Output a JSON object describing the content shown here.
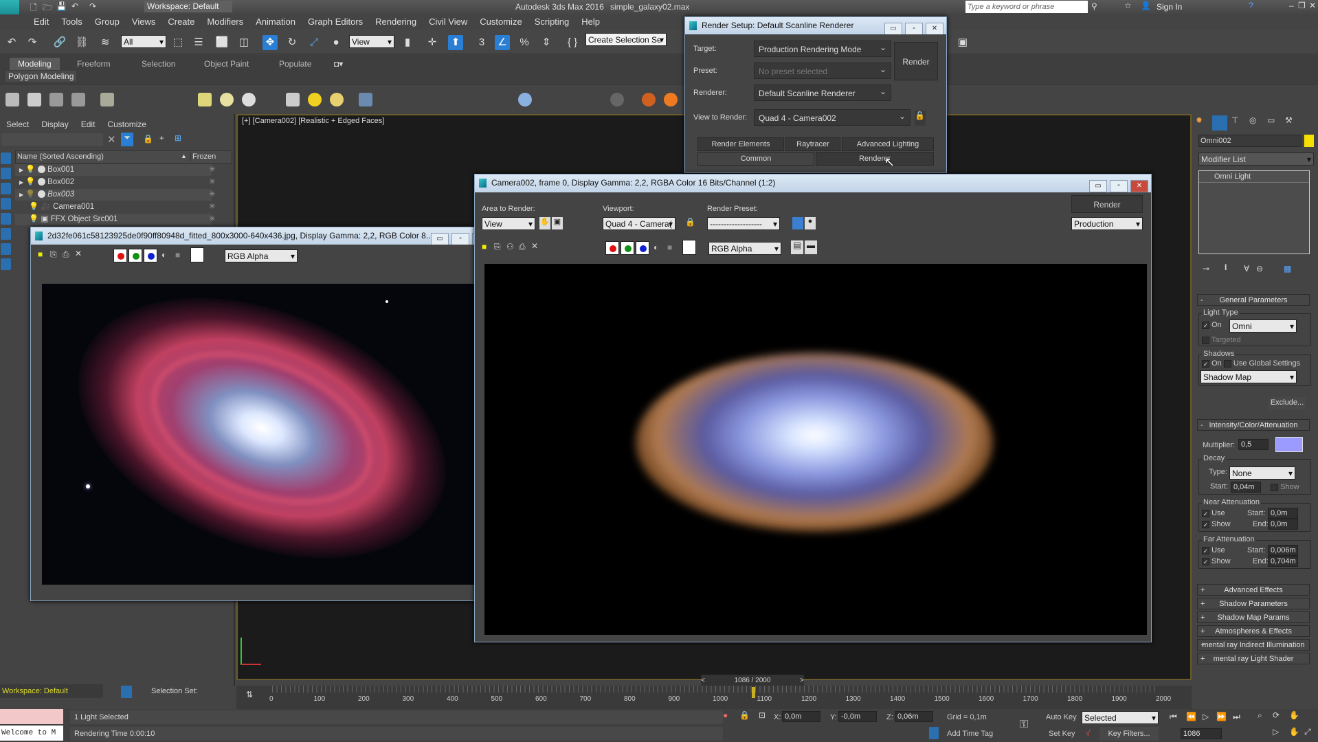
{
  "app": {
    "title": "Autodesk 3ds Max 2016",
    "file": "simple_galaxy02.max",
    "logo_text": "MAX",
    "workspace": "Workspace: Default",
    "search_placeholder": "Type a keyword or phrase",
    "sign_in": "Sign In"
  },
  "menu": [
    "Edit",
    "Tools",
    "Group",
    "Views",
    "Create",
    "Modifiers",
    "Animation",
    "Graph Editors",
    "Rendering",
    "Civil View",
    "Customize",
    "Scripting",
    "Help"
  ],
  "toolbar": {
    "selection_filter": "All",
    "ref_coord": "View",
    "named_selection": "Create Selection Se",
    "snap_number": "3"
  },
  "ribbon": {
    "tabs": [
      "Modeling",
      "Freeform",
      "Selection",
      "Object Paint",
      "Populate"
    ],
    "active_tab": "Modeling",
    "panel": "Polygon Modeling"
  },
  "explorer": {
    "menu": [
      "Select",
      "Display",
      "Edit",
      "Customize"
    ],
    "col_name": "Name (Sorted Ascending)",
    "col_frozen": "Frozen",
    "rows": [
      {
        "name": "Box001"
      },
      {
        "name": "Box002"
      },
      {
        "name": "Box003"
      },
      {
        "name": "Camera001"
      },
      {
        "name": "FFX Object Src001"
      }
    ]
  },
  "viewport": {
    "label": "[+] [Camera002] [Realistic + Edged Faces]"
  },
  "render_setup": {
    "title": "Render Setup: Default Scanline Renderer",
    "target_label": "Target:",
    "target": "Production Rendering Mode",
    "preset_label": "Preset:",
    "preset": "No preset selected",
    "renderer_label": "Renderer:",
    "renderer": "Default Scanline Renderer",
    "view_label": "View to Render:",
    "view": "Quad 4 - Camera002",
    "render": "Render",
    "tabs_row1": [
      "Render Elements",
      "Raytracer",
      "Advanced Lighting"
    ],
    "tabs_row2": [
      "Common",
      "Renderer"
    ]
  },
  "image_window": {
    "title": "2d32fe061c58123925de0f90ff80948d_fitted_800x3000-640x436.jpg, Display Gamma: 2,2, RGB Color 8...",
    "channel": "RGB Alpha"
  },
  "frame_window": {
    "title": "Camera002, frame 0, Display Gamma: 2,2, RGBA Color 16 Bits/Channel (1:2)",
    "area_label": "Area to Render:",
    "area": "View",
    "viewport_label": "Viewport:",
    "viewport": "Quad 4 - Camera(",
    "preset_label": "Render Preset:",
    "preset": "-------------------",
    "render": "Render",
    "mode": "Production",
    "channel": "RGB Alpha"
  },
  "command_panel": {
    "object_name": "Omni002",
    "object_color": "#f5e000",
    "modifier_list": "Modifier List",
    "stack_item": "Omni Light",
    "general": "General Parameters",
    "light_type": "Light Type",
    "on": "On",
    "type": "Omni",
    "targeted": "Targeted",
    "shadows": "Shadows",
    "use_global": "Use Global Settings",
    "shadow_type": "Shadow Map",
    "exclude": "Exclude...",
    "intensity": "Intensity/Color/Attenuation",
    "multiplier_label": "Multiplier:",
    "multiplier": "0,5",
    "light_color": "#9a9aff",
    "decay": "Decay",
    "type_label": "Type:",
    "decay_type": "None",
    "start_label": "Start:",
    "decay_start": "0,04m",
    "show": "Show",
    "near": "Near Attenuation",
    "use": "Use",
    "end_label": "End:",
    "near_start": "0,0m",
    "near_end": "0,0m",
    "far": "Far Attenuation",
    "far_start": "0,006m",
    "far_end": "0,704m",
    "rollouts": [
      "Advanced Effects",
      "Shadow Parameters",
      "Shadow Map Params",
      "Atmospheres & Effects",
      "mental ray Indirect Illumination",
      "mental ray Light Shader"
    ]
  },
  "timeline": {
    "frame": "1086 / 2000",
    "current": 1086,
    "max": 2000,
    "ticks": [
      "0",
      "100",
      "200",
      "300",
      "400",
      "500",
      "600",
      "700",
      "800",
      "900",
      "1000",
      "1100",
      "1200",
      "1300",
      "1400",
      "1500",
      "1600",
      "1700",
      "1800",
      "1900",
      "2000"
    ]
  },
  "status": {
    "workspace": "Workspace: Default",
    "selection_set": "Selection Set:",
    "maxscript": "Welcome to M",
    "selected": "1 Light Selected",
    "render_time": "Rendering Time  0:00:10",
    "x_label": "X:",
    "x": "0,0m",
    "y_label": "Y:",
    "y": "-0,0m",
    "z_label": "Z:",
    "z": "0,06m",
    "grid": "Grid = 0,1m",
    "add_time_tag": "Add Time Tag",
    "auto_key": "Auto Key",
    "set_key": "Set Key",
    "key_mode": "Selected",
    "key_filters": "Key Filters...",
    "frame_field": "1086"
  }
}
